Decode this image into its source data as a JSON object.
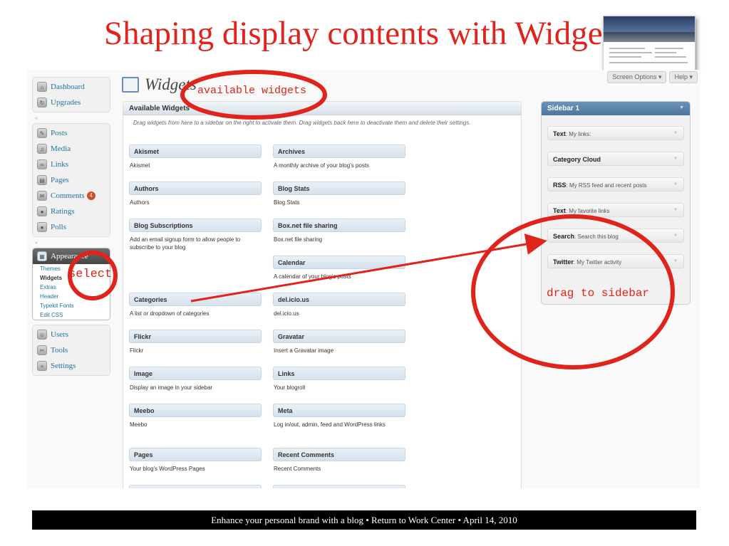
{
  "slide": {
    "title": "Shaping display contents with Widgets",
    "footer": "Enhance your personal brand with a blog   •   Return to Work Center   •   April 14, 2010"
  },
  "top_buttons": [
    "Screen Options ▾",
    "Help ▾"
  ],
  "admin_menu": {
    "group1": [
      {
        "label": "Dashboard",
        "icon": "dashboard-icon"
      },
      {
        "label": "Upgrades",
        "icon": "upgrades-icon"
      }
    ],
    "group2": [
      {
        "label": "Posts",
        "icon": "posts-icon"
      },
      {
        "label": "Media",
        "icon": "media-icon"
      },
      {
        "label": "Links",
        "icon": "links-icon"
      },
      {
        "label": "Pages",
        "icon": "pages-icon"
      },
      {
        "label": "Comments",
        "icon": "comments-icon",
        "badge": "4"
      },
      {
        "label": "Ratings",
        "icon": "ratings-icon"
      },
      {
        "label": "Polls",
        "icon": "polls-icon"
      }
    ],
    "appearance": {
      "label": "Appearance",
      "items": [
        "Themes",
        "Widgets",
        "Extras",
        "Header",
        "Typekit Fonts",
        "Edit CSS"
      ],
      "current": "Widgets"
    },
    "group3": [
      {
        "label": "Users",
        "icon": "users-icon"
      },
      {
        "label": "Tools",
        "icon": "tools-icon"
      },
      {
        "label": "Settings",
        "icon": "settings-icon"
      }
    ]
  },
  "page_title": "Widgets",
  "available": {
    "heading": "Available Widgets",
    "description": "Drag widgets from here to a sidebar on the right to activate them. Drag widgets back here to deactivate them and delete their settings.",
    "left": [
      {
        "name": "Akismet",
        "desc": "Akismet"
      },
      {
        "name": "Authors",
        "desc": "Authors"
      },
      {
        "name": "Blog Subscriptions",
        "desc": "Add an email signup form to allow people to subscribe to your blog"
      },
      {
        "name": "Categories",
        "desc": "A list or dropdown of categories"
      },
      {
        "name": "Flickr",
        "desc": "Flickr"
      },
      {
        "name": "Image",
        "desc": "Display an image in your sidebar"
      },
      {
        "name": "Meebo",
        "desc": "Meebo"
      },
      {
        "name": "Pages",
        "desc": "Your blog's WordPress Pages"
      },
      {
        "name": "",
        "desc": ""
      }
    ],
    "right": [
      {
        "name": "Archives",
        "desc": "A monthly archive of your blog's posts"
      },
      {
        "name": "Blog Stats",
        "desc": "Blog Stats"
      },
      {
        "name": "Box.net file sharing",
        "desc": "Box.net file sharing"
      },
      {
        "name": "Calendar",
        "desc": "A calendar of your blog's posts"
      },
      {
        "name": "del.icio.us",
        "desc": "del.icio.us"
      },
      {
        "name": "Gravatar",
        "desc": "Insert a Gravatar image"
      },
      {
        "name": "Links",
        "desc": "Your blogroll"
      },
      {
        "name": "Meta",
        "desc": "Log in/out, admin, feed and WordPress links"
      },
      {
        "name": "Recent Comments",
        "desc": "Recent Comments"
      },
      {
        "name": "",
        "desc": ""
      }
    ]
  },
  "sidebar": {
    "heading": "Sidebar 1",
    "items": [
      {
        "name": "Text",
        "title": ": My links:"
      },
      {
        "name": "Category Cloud",
        "title": ""
      },
      {
        "name": "RSS",
        "title": ": My RSS feed and recent posts"
      },
      {
        "name": "Text",
        "title": ": My favorite links"
      },
      {
        "name": "Search",
        "title": ": Search this blog"
      },
      {
        "name": "Twitter",
        "title": ": My Twitter activity"
      }
    ]
  },
  "annotations": {
    "available": "available widgets",
    "select": "select",
    "drag": "drag to sidebar",
    "color": "#e0241b"
  }
}
